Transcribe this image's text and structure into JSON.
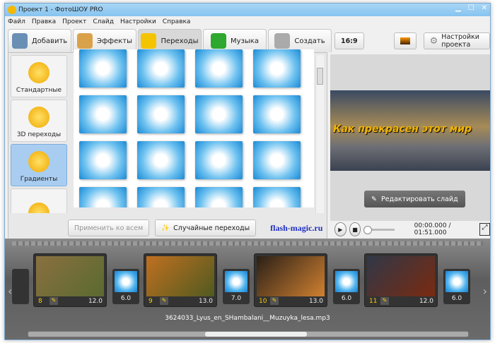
{
  "window": {
    "title": "Проект 1 - ФотоШОУ PRO",
    "controls": [
      "▁",
      "☐",
      "✕"
    ]
  },
  "menu": [
    "Файл",
    "Правка",
    "Проект",
    "Слайд",
    "Настройки",
    "Справка"
  ],
  "tabs": [
    {
      "label": "Добавить",
      "icon": "camera-icon",
      "color": "#6a8fb5"
    },
    {
      "label": "Эффекты",
      "icon": "palette-icon",
      "color": "#d9a24a"
    },
    {
      "label": "Переходы",
      "icon": "star-icon",
      "color": "#f5c400"
    },
    {
      "label": "Музыка",
      "icon": "music-note-icon",
      "color": "#2ea82e"
    },
    {
      "label": "Создать",
      "icon": "film-reel-icon",
      "color": "#aaaaaa"
    }
  ],
  "active_tab": "Переходы",
  "categories": [
    {
      "label": "Стандартные",
      "icon": "star-icon"
    },
    {
      "label": "3D переходы",
      "icon": "3d-icon"
    },
    {
      "label": "Градиенты",
      "icon": "gradient-icon"
    },
    {
      "label": "",
      "icon": "folder-icon"
    }
  ],
  "active_category": "Градиенты",
  "grid_count": 16,
  "buttons": {
    "apply_all": "Применить ко всем",
    "random": "Случайные переходы"
  },
  "watermark": "flash-magic.ru",
  "right": {
    "ratio": "16:9",
    "settings": "Настройки проекта",
    "preview_text": "Как прекрасен этот мир",
    "edit_slide": "Редактировать слайд",
    "time": "00:00.000 / 01:51.000"
  },
  "timeline": {
    "slides": [
      {
        "num": "8",
        "duration": "12.0",
        "colors": [
          "#8a7040",
          "#5a6a30"
        ]
      },
      {
        "num": "9",
        "duration": "13.0",
        "colors": [
          "#c07020",
          "#505a20"
        ]
      },
      {
        "num": "10",
        "duration": "13.0",
        "colors": [
          "#2a2018",
          "#d08030"
        ]
      },
      {
        "num": "11",
        "duration": "12.0",
        "colors": [
          "#303848",
          "#7a2a10"
        ]
      }
    ],
    "transitions": [
      "6.0",
      "7.0",
      "6.0",
      "6.0"
    ],
    "audio": "3624033_Lyus_en_SHambalani__Muzuyka_lesa.mp3"
  }
}
